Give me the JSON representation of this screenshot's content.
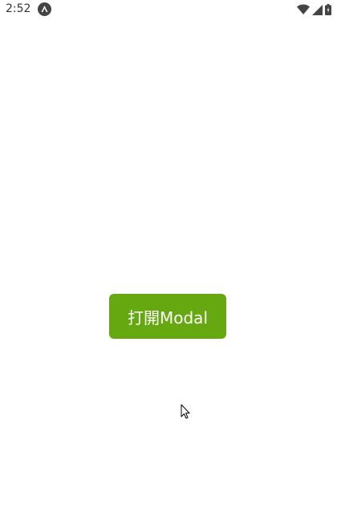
{
  "status_bar": {
    "time": "2:52",
    "app_icon": "expo-app-icon",
    "wifi_icon": "wifi-icon",
    "signal_icon": "cell-signal-icon",
    "battery_icon": "battery-icon"
  },
  "main": {
    "open_modal_label": "打開Modal",
    "button_color": "#66a80f"
  }
}
